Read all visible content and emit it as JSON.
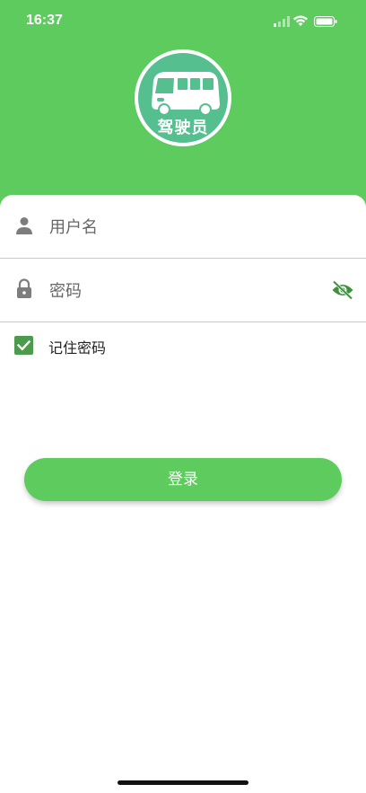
{
  "status_bar": {
    "time": "16:37",
    "icons": [
      "signal-icon",
      "wifi-icon",
      "battery-icon"
    ]
  },
  "logo": {
    "text": "驾驶员",
    "icon": "bus-icon"
  },
  "form": {
    "username_placeholder": "用户名",
    "username_icon": "person-icon",
    "password_placeholder": "密码",
    "password_icon": "lock-icon",
    "visibility_icon": "eye-off-icon",
    "remember_label": "记住密码",
    "remember_checked": true
  },
  "login_button_label": "登录",
  "colors": {
    "brand_green": "#5ecb5e",
    "checkbox_green": "#4c9a4c",
    "eye_icon_green": "#3f8f3f"
  }
}
